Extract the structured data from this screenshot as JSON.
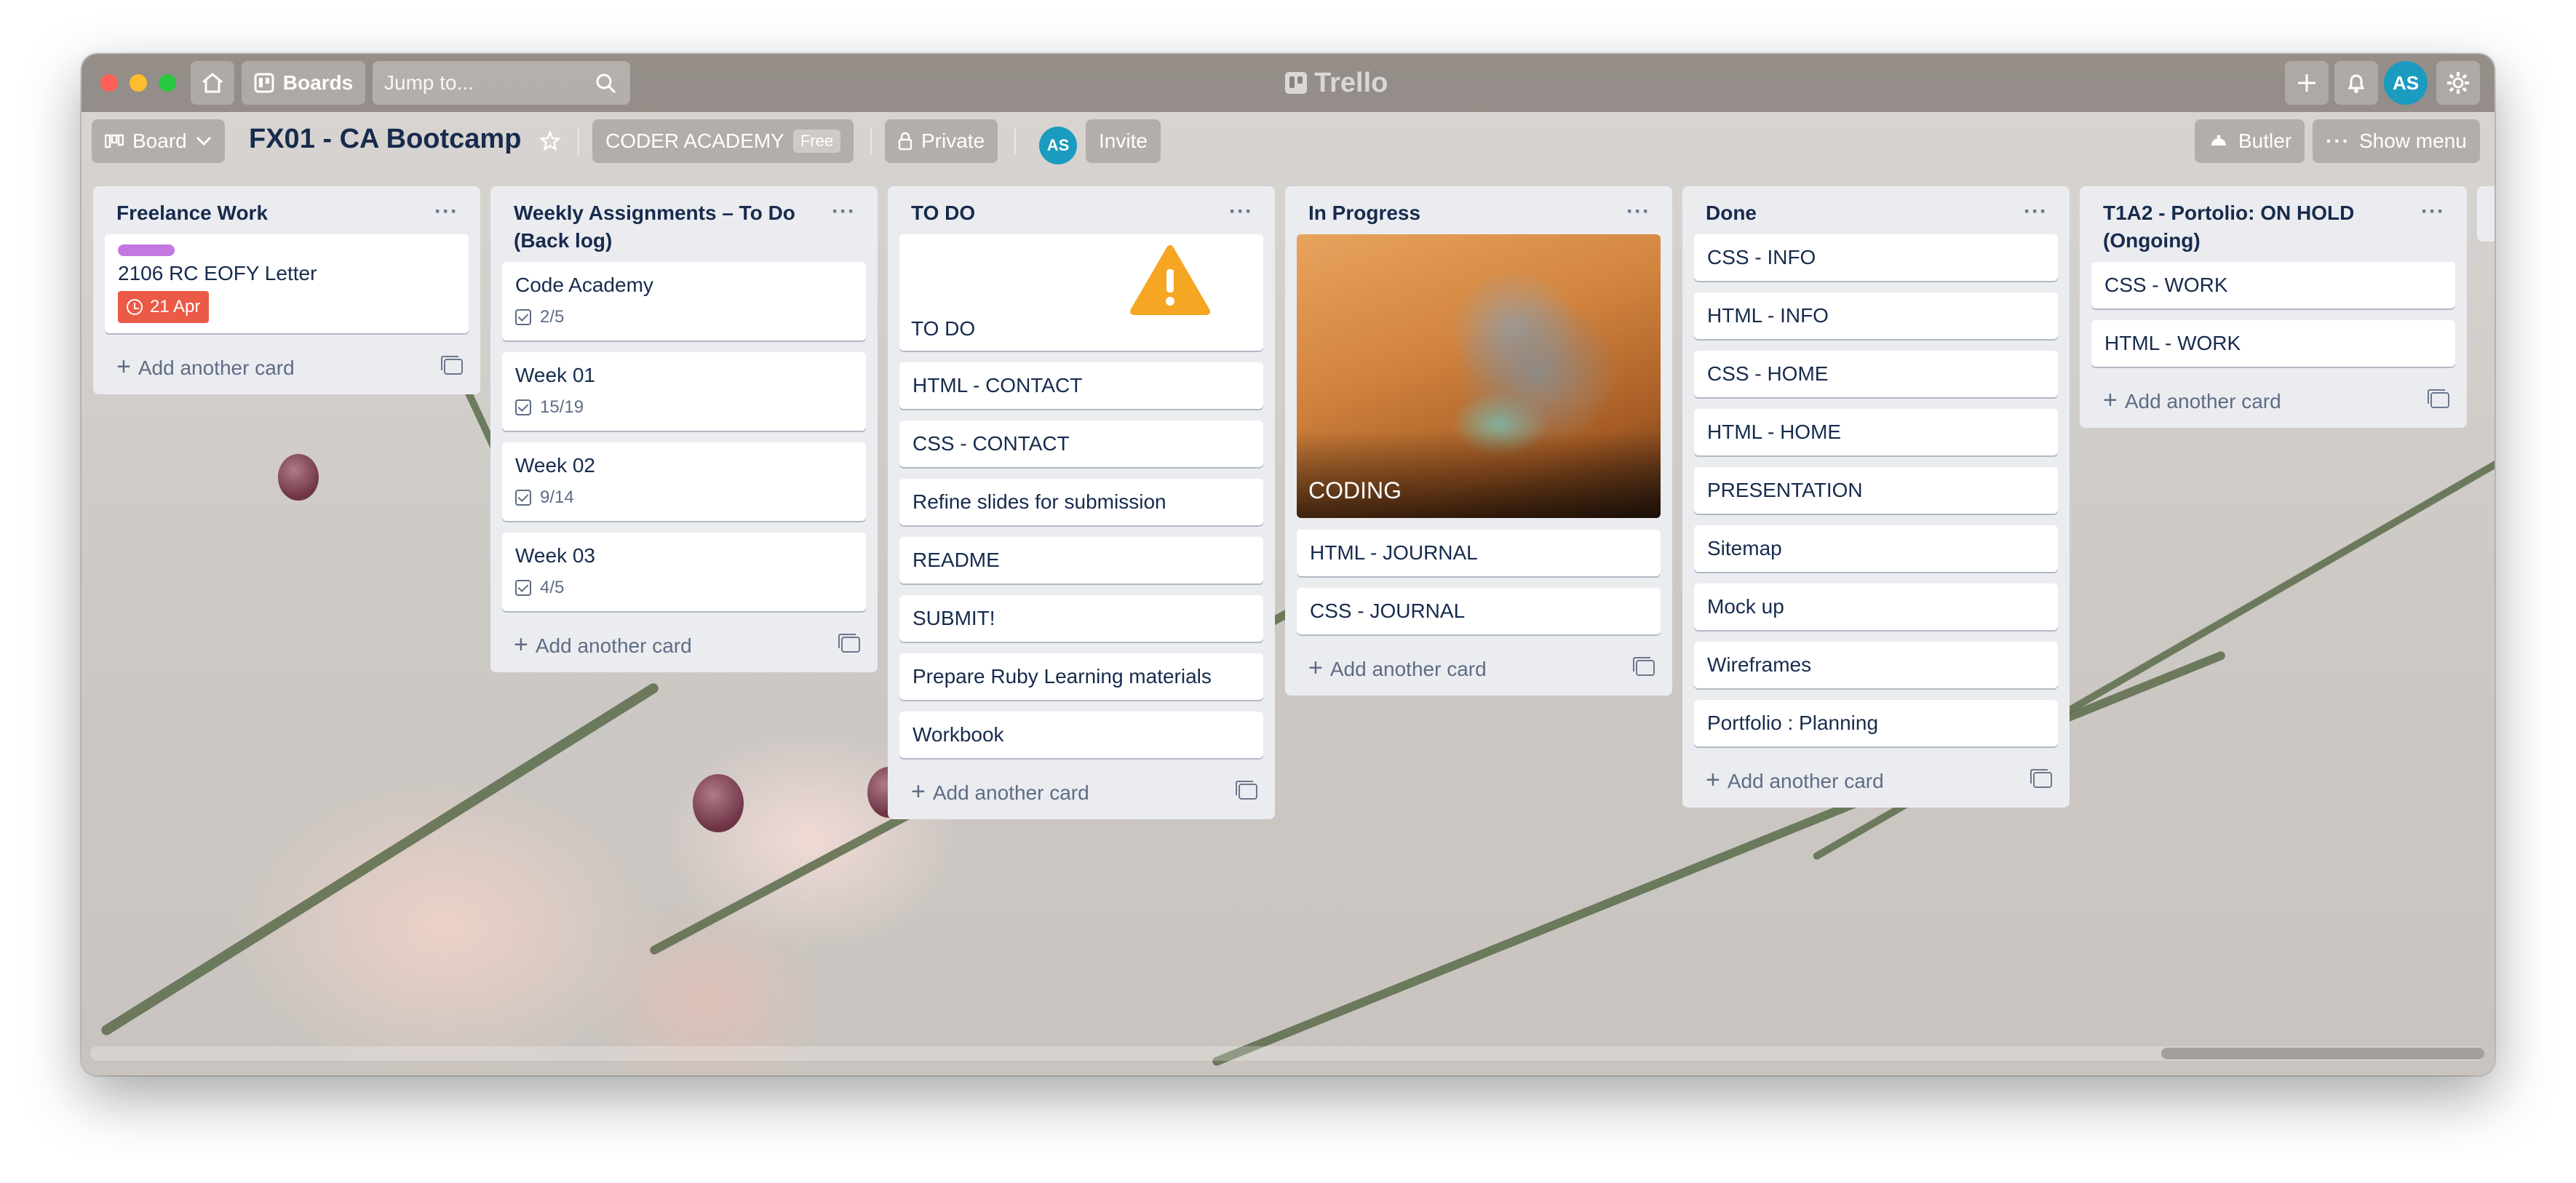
{
  "topbar": {
    "boards_label": "Boards",
    "search_placeholder": "Jump to...",
    "logo_text": "Trello",
    "user_initials": "AS"
  },
  "board": {
    "view_label": "Board",
    "title": "FX01 - CA Bootcamp",
    "team_name": "CODER ACADEMY",
    "team_plan": "Free",
    "visibility": "Private",
    "member_initials": "AS",
    "invite_label": "Invite",
    "butler_label": "Butler",
    "menu_label": "Show menu"
  },
  "colors": {
    "label_purple": "#c377e0",
    "due_red": "#eb5a46",
    "avatar_blue": "#1a9bbf",
    "warning_orange": "#f5a623"
  },
  "add_card_label": "Add another card",
  "lists": [
    {
      "title": "Freelance Work",
      "cards": [
        {
          "title": "2106 RC EOFY Letter",
          "label": "purple",
          "due": "21 Apr"
        }
      ]
    },
    {
      "title": "Weekly Assignments – To Do (Back log)",
      "cards": [
        {
          "title": "Code Academy",
          "checklist": "2/5"
        },
        {
          "title": "Week 01",
          "checklist": "15/19"
        },
        {
          "title": "Week 02",
          "checklist": "9/14"
        },
        {
          "title": "Week 03",
          "checklist": "4/5"
        }
      ]
    },
    {
      "title": "TO DO",
      "cards": [
        {
          "title": "TO DO",
          "cover": "warning-icon"
        },
        {
          "title": "HTML - CONTACT"
        },
        {
          "title": "CSS - CONTACT"
        },
        {
          "title": "Refine slides for submission"
        },
        {
          "title": "README"
        },
        {
          "title": "SUBMIT!"
        },
        {
          "title": "Prepare Ruby Learning materials"
        },
        {
          "title": "Workbook"
        }
      ]
    },
    {
      "title": "In Progress",
      "cards": [
        {
          "title": "CODING",
          "cover": "cat-photo"
        },
        {
          "title": "HTML - JOURNAL"
        },
        {
          "title": "CSS - JOURNAL"
        }
      ]
    },
    {
      "title": "Done",
      "cards": [
        {
          "title": "CSS - INFO"
        },
        {
          "title": "HTML - INFO"
        },
        {
          "title": "CSS - HOME"
        },
        {
          "title": "HTML - HOME"
        },
        {
          "title": "PRESENTATION"
        },
        {
          "title": "Sitemap"
        },
        {
          "title": "Mock up"
        },
        {
          "title": "Wireframes"
        },
        {
          "title": "Portfolio : Planning"
        }
      ]
    },
    {
      "title": "T1A2 - Portolio: ON HOLD (Ongoing)",
      "cards": [
        {
          "title": "CSS - WORK"
        },
        {
          "title": "HTML - WORK"
        }
      ]
    }
  ]
}
